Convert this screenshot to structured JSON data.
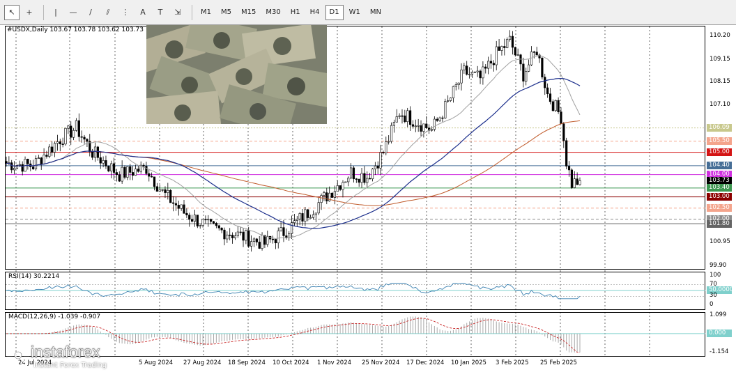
{
  "toolbar": {
    "tools": [
      {
        "name": "cursor-tool",
        "glyph": "↖"
      },
      {
        "name": "crosshair-tool",
        "glyph": "+"
      },
      {
        "name": "vertical-line-tool",
        "glyph": "|"
      },
      {
        "name": "horizontal-line-tool",
        "glyph": "—"
      },
      {
        "name": "trendline-tool",
        "glyph": "/"
      },
      {
        "name": "equidistant-channel-tool",
        "glyph": "⫽"
      },
      {
        "name": "fibonacci-tool",
        "glyph": "⋮"
      },
      {
        "name": "text-tool",
        "glyph": "A"
      },
      {
        "name": "text-label-tool",
        "glyph": "T"
      },
      {
        "name": "arrows-tool",
        "glyph": "⇲"
      }
    ],
    "timeframes": [
      "M1",
      "M5",
      "M15",
      "M30",
      "H1",
      "H4",
      "D1",
      "W1",
      "MN"
    ],
    "active_timeframe": "D1"
  },
  "chart": {
    "symbol_line": "#USDX,Daily  103.67 103.78 103.62 103.73",
    "price_scale": [
      "110.20",
      "109.15",
      "108.15",
      "107.10",
      "106.09",
      "105.50",
      "105.00",
      "104.40",
      "104.00",
      "103.73",
      "103.40",
      "103.00",
      "102.50",
      "102.00",
      "101.80",
      "100.95",
      "99.90"
    ],
    "price_tags": [
      {
        "label": "106.09",
        "color": "#c8c88c",
        "value": 106.09
      },
      {
        "label": "105.50",
        "color": "#f4a48c",
        "value": 105.5
      },
      {
        "label": "105.00",
        "color": "#d41414",
        "value": 105.0
      },
      {
        "label": "104.40",
        "color": "#466e96",
        "value": 104.4
      },
      {
        "label": "104.00",
        "color": "#d030e0",
        "value": 104.0
      },
      {
        "label": "103.73",
        "color": "#000000",
        "value": 103.73
      },
      {
        "label": "103.40",
        "color": "#3c9650",
        "value": 103.4
      },
      {
        "label": "103.00",
        "color": "#8c0000",
        "value": 103.0
      },
      {
        "label": "102.50",
        "color": "#f4a48c",
        "value": 102.5
      },
      {
        "label": "102.00",
        "color": "#8c8c8c",
        "value": 102.0
      },
      {
        "label": "101.80",
        "color": "#646464",
        "value": 101.8
      }
    ],
    "dates": [
      "24 Jul 2024",
      "5 Aug 2024",
      "27 Aug 2024",
      "18 Sep 2024",
      "10 Oct 2024",
      "1 Nov 2024",
      "25 Nov 2024",
      "17 Dec 2024",
      "10 Jan 2025",
      "3 Feb 2025",
      "25 Feb 2025"
    ]
  },
  "rsi": {
    "label": "RSI(14) 30.2214",
    "scale": [
      "100",
      "70",
      "50.0000",
      "30",
      "0"
    ]
  },
  "macd": {
    "label": "MACD(12,26,9) -1.039 -0.907",
    "scale": [
      "1.099",
      "0.000",
      "-1.154"
    ]
  },
  "watermark": {
    "brand": "instaforex",
    "tagline": "Instant Forex Trading"
  },
  "colors": {
    "ma_blue": "#1c2f8c",
    "ma_orange": "#c05a2a",
    "ma_gray": "#a0a0a0",
    "rsi_line": "#3a80b0",
    "macd_signal": "#c82020",
    "candle": "#000000"
  }
}
